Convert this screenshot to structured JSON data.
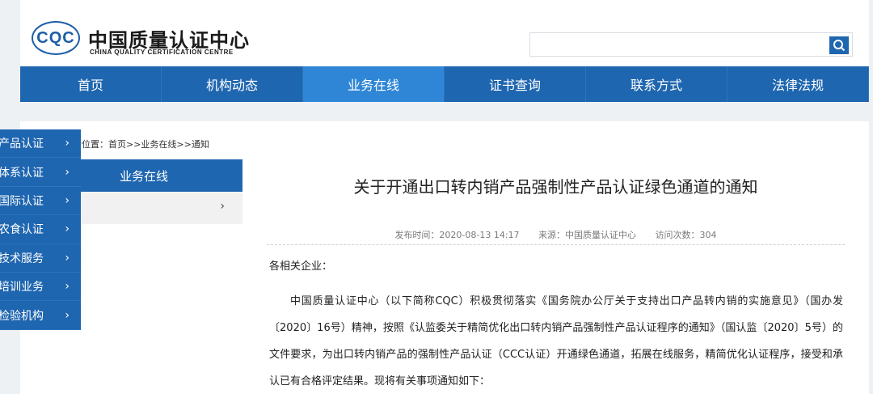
{
  "header": {
    "logo_text": "CQC",
    "org_name_cn": "中国质量认证中心",
    "org_name_en": "CHINA QUALITY CERTIFICATION CENTRE",
    "search_placeholder": "",
    "search_icon": "search-icon"
  },
  "nav": {
    "items": [
      {
        "label": "首页"
      },
      {
        "label": "机构动态"
      },
      {
        "label": "业务在线",
        "active": true
      },
      {
        "label": "证书查询"
      },
      {
        "label": "联系方式"
      },
      {
        "label": "法律法规"
      }
    ]
  },
  "sidebar": {
    "items": [
      {
        "label": "产品认证"
      },
      {
        "label": "体系认证"
      },
      {
        "label": "国际认证"
      },
      {
        "label": "农食认证"
      },
      {
        "label": "技术服务"
      },
      {
        "label": "培训业务"
      },
      {
        "label": "检验机构"
      }
    ],
    "chevron": "›"
  },
  "breadcrumb": "的位置：首页>>业务在线>>通知",
  "left_panel": {
    "header": "业务在线",
    "chevron": "›"
  },
  "article": {
    "title": "关于开通出口转内销产品强制性产品认证绿色通道的通知",
    "publish_time": "发布时间：2020-08-13 14:17",
    "source": "来源：中国质量认证中心",
    "visits": "访问次数：304",
    "salutation": "各相关企业：",
    "paragraph": "中国质量认证中心（以下简称CQC）积极贯彻落实《国务院办公厅关于支持出口产品转内销的实施意见》（国办发〔2020〕16号）精神，按照《认监委关于精简优化出口转内销产品强制性产品认证程序的通知》（国认监〔2020〕5号）的文件要求，为出口转内销产品的强制性产品认证（CCC认证）开通绿色通道，拓展在线服务，精简优化认证程序，接受和承认已有合格评定结果。现将有关事项通知如下："
  },
  "colors": {
    "brand_blue": "#1f66b0",
    "active_tab": "#2f86d6"
  }
}
